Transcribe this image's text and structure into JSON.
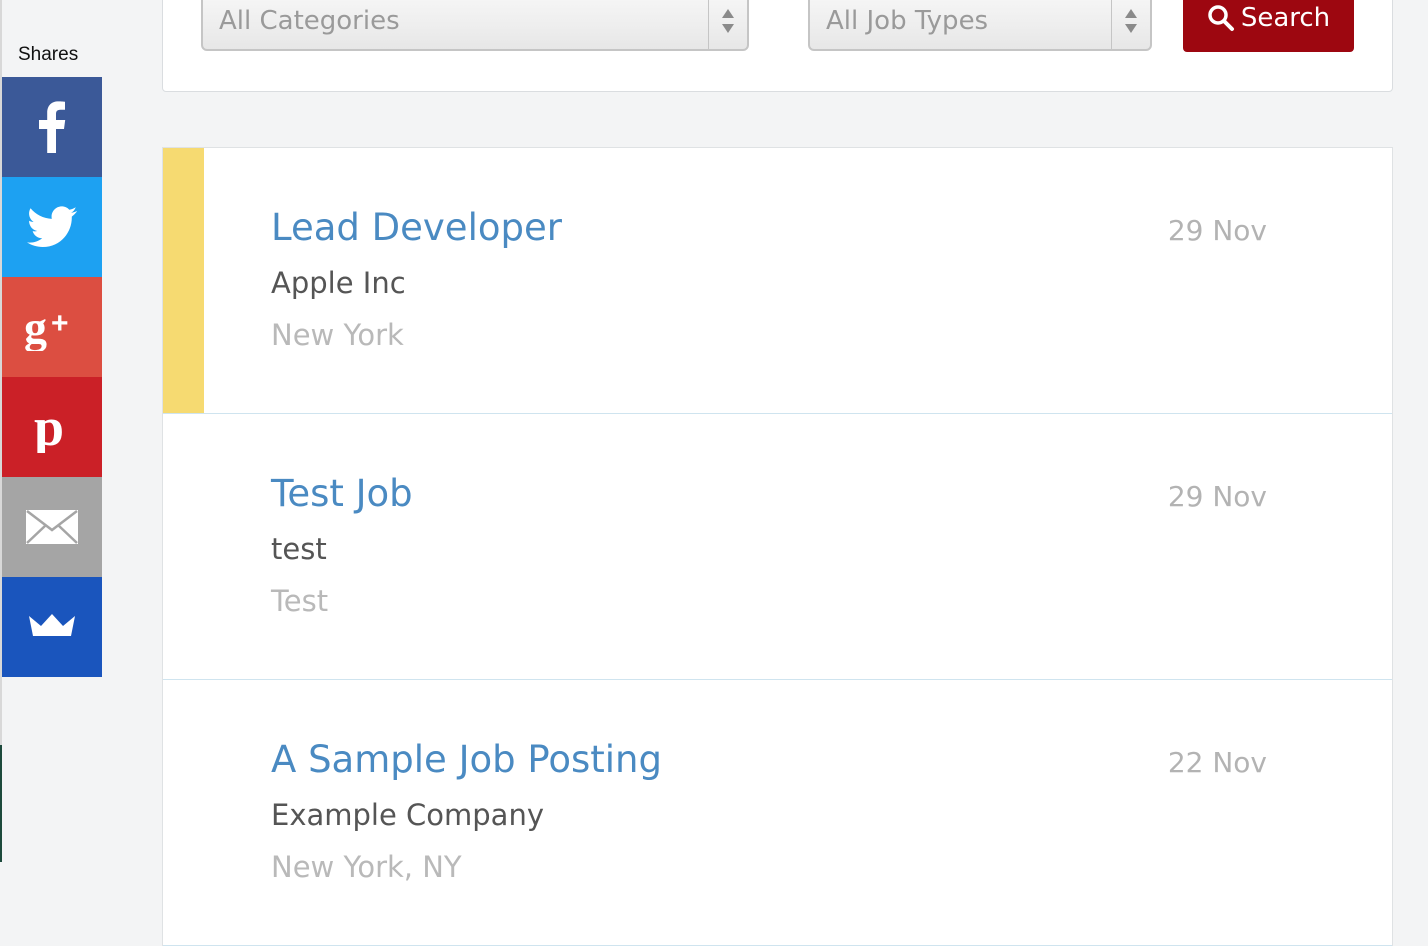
{
  "share_bar": {
    "label": "Shares",
    "buttons": [
      {
        "name": "facebook",
        "icon": "facebook-icon",
        "color": "#3b5998"
      },
      {
        "name": "twitter",
        "icon": "twitter-icon",
        "color": "#1da1f2"
      },
      {
        "name": "google-plus",
        "icon": "google-plus-icon",
        "color": "#dc4e41"
      },
      {
        "name": "pinterest",
        "icon": "pinterest-icon",
        "color": "#cb2027"
      },
      {
        "name": "email",
        "icon": "envelope-icon",
        "color": "#a5a5a5"
      },
      {
        "name": "sumome",
        "icon": "crown-icon",
        "color": "#1a55bd"
      }
    ]
  },
  "search": {
    "category_select": "All Categories",
    "job_type_select": "All Job Types",
    "button_label": "Search",
    "button_color": "#9d0710"
  },
  "jobs": [
    {
      "title": "Lead Developer",
      "company": "Apple Inc",
      "location": "New York",
      "date": "29 Nov",
      "featured": true
    },
    {
      "title": "Test Job",
      "company": "test",
      "location": "Test",
      "date": "29 Nov",
      "featured": false
    },
    {
      "title": "A Sample Job Posting",
      "company": "Example Company",
      "location": "New York, NY",
      "date": "22 Nov",
      "featured": false
    }
  ],
  "colors": {
    "featured_accent": "#f6da71",
    "job_title": "#4a8ac2"
  }
}
